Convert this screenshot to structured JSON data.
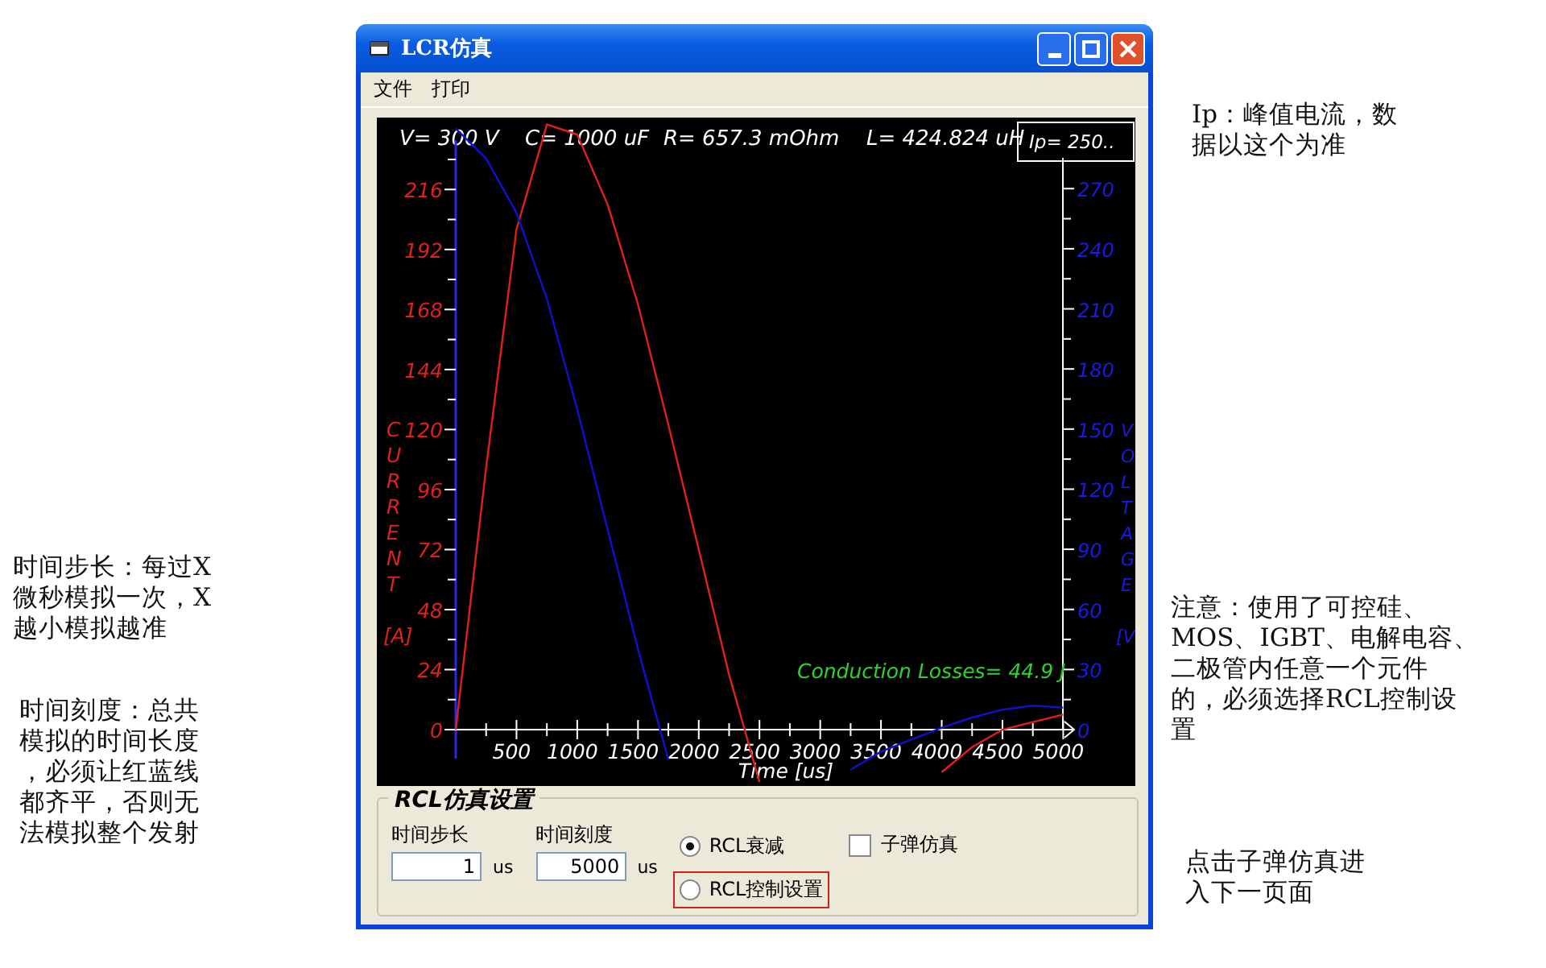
{
  "notes_left": [
    {
      "lines": [
        "时间步长：每过X",
        "微秒模拟一次，X",
        "越小模拟越准"
      ]
    },
    {
      "lines": [
        "时间刻度：总共",
        "模拟的时间长度",
        "，必须让红蓝线",
        "都齐平，否则无",
        "法模拟整个发射"
      ]
    }
  ],
  "window": {
    "title": "LCR仿真"
  },
  "menu": [
    "文件",
    "打印"
  ],
  "chart": {
    "params": [
      "V= 300 V",
      "C= 1000 uF",
      "R= 657.3 mOhm",
      "L= 424.824 uH"
    ],
    "peak": "Ip= 250..",
    "losses": "Conduction Losses= 44.9 J",
    "chart_data": {
      "type": "line",
      "xlabel": "Time [us]",
      "ylabel": "CURRENT [A]",
      "y2label": "VOLTAGE [V",
      "x": [
        0,
        250,
        500,
        750,
        1000,
        1250,
        1500,
        1750,
        2000,
        2250,
        2500,
        3250,
        3500,
        3750,
        4000,
        4250,
        4500,
        4750,
        5000
      ],
      "xlim": [
        0,
        5090
      ],
      "ylim": [
        -22,
        244
      ],
      "y2lim": [
        -28,
        304
      ],
      "xticks": [
        500,
        1000,
        1500,
        2000,
        2500,
        3000,
        3500,
        4000,
        4500,
        5000
      ],
      "yticks": [
        0,
        24,
        48,
        72,
        96,
        120,
        144,
        168,
        192,
        216
      ],
      "y2ticks": [
        0,
        30,
        60,
        90,
        120,
        150,
        180,
        210,
        240,
        270
      ],
      "series": [
        {
          "color": "#e0201c",
          "axis": "y",
          "values": [
            0,
            105,
            200,
            242,
            238,
            210,
            170,
            122,
            72,
            22,
            -21,
            null,
            null,
            null,
            -17,
            -7,
            0,
            3,
            6
          ]
        },
        {
          "color": "#1010d0",
          "axis": "y2",
          "values": [
            300,
            285,
            258,
            215,
            160,
            100,
            40,
            -15,
            null,
            null,
            null,
            -20,
            -11,
            -5,
            1,
            6,
            10,
            12,
            11
          ]
        }
      ]
    }
  },
  "settings": {
    "title": "RCL仿真设置",
    "fields": [
      {
        "label": "时间步长",
        "value": "1",
        "unit": "us"
      },
      {
        "label": "时间刻度",
        "value": "5000",
        "unit": "us"
      }
    ],
    "radios": [
      {
        "label": "RCL衰减",
        "selected": true,
        "highlighted": false
      },
      {
        "label": "RCL控制设置",
        "selected": false,
        "highlighted": true
      }
    ],
    "checkbox": {
      "label": "子弹仿真",
      "checked": false
    }
  },
  "notes_right": [
    {
      "lines": [
        "Ip：峰值电流，数",
        "据以这个为准"
      ]
    },
    {
      "lines": [
        "注意：使用了可控硅、",
        "MOS、IGBT、电解电容、",
        "二极管内任意一个元件",
        "的，必须选择RCL控制设",
        "置"
      ]
    },
    {
      "lines": [
        "点击子弹仿真进",
        "入下一页面"
      ]
    }
  ]
}
